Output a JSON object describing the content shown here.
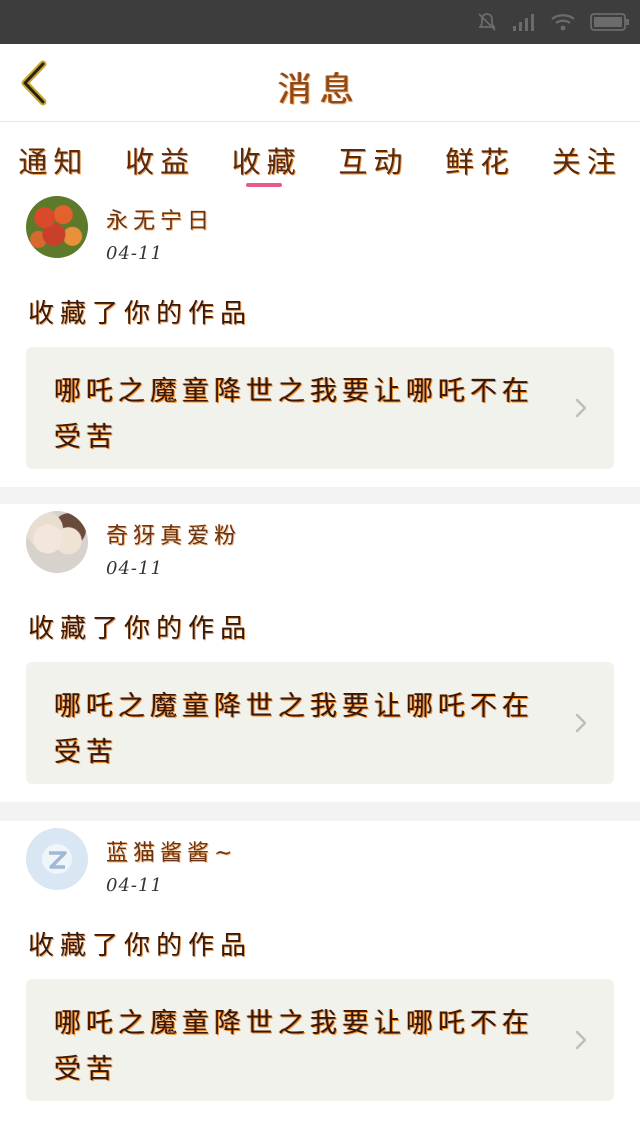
{
  "header": {
    "title": "消息"
  },
  "tabs": [
    {
      "label": "通知"
    },
    {
      "label": "收益"
    },
    {
      "label": "收藏",
      "active": true
    },
    {
      "label": "互动"
    },
    {
      "label": "鲜花"
    },
    {
      "label": "关注"
    }
  ],
  "feed": [
    {
      "username": "永无宁日",
      "date": "04-11",
      "action": "收藏了你的作品",
      "work_title": "哪吒之魔童降世之我要让哪吒不在受苦"
    },
    {
      "username": "奇犽真爱粉",
      "date": "04-11",
      "action": "收藏了你的作品",
      "work_title": "哪吒之魔童降世之我要让哪吒不在受苦"
    },
    {
      "username": "蓝猫酱酱~",
      "date": "04-11",
      "action": "收藏了你的作品",
      "work_title": "哪吒之魔童降世之我要让哪吒不在受苦"
    }
  ],
  "colors": {
    "active_tab_indicator": "#e85a8c",
    "work_card_bg": "#f2f2ec",
    "status_bar": "#3d3d3d"
  }
}
